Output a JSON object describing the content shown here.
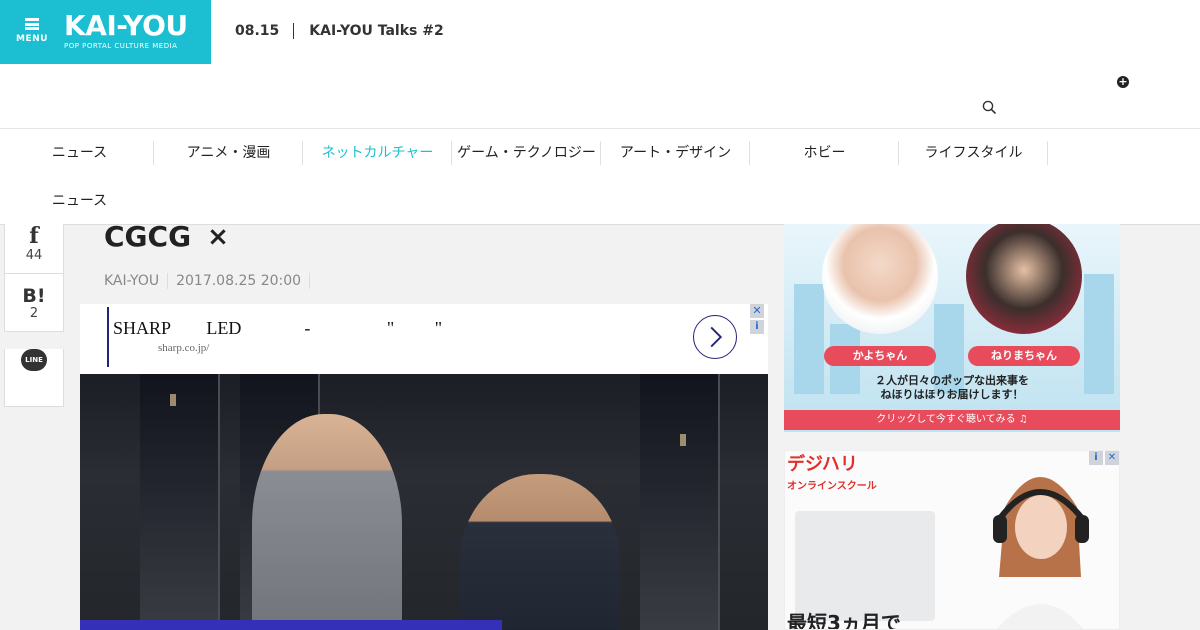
{
  "header": {
    "menu_label": "MENU",
    "brand_name": "KAI-YOU",
    "brand_tagline": "POP PORTAL CULTURE MEDIA",
    "ticker_date": "08.15",
    "ticker_headline": "KAI-YOU Talks #2",
    "plus_icon": "+"
  },
  "nav": {
    "items": [
      {
        "label": "ニュース"
      },
      {
        "label": "アニメ・漫画"
      },
      {
        "label": "ネットカルチャー"
      },
      {
        "label": "ゲーム・テクノロジー"
      },
      {
        "label": "アート・デザイン"
      },
      {
        "label": "ホビー"
      },
      {
        "label": "ライフスタイル"
      },
      {
        "label": "ニュース"
      }
    ],
    "active_index": 2
  },
  "share": {
    "facebook_glyph": "f",
    "facebook_count": "44",
    "hatena_glyph": "B!",
    "hatena_count": "2",
    "line_glyph": "LINE"
  },
  "article": {
    "title": "CGCG",
    "title_mark": "×",
    "author": "KAI-YOU",
    "timestamp": "2017.08.25 20:00"
  },
  "text_ad": {
    "line1": "SHARP        LED              -                 \"         \"",
    "url": "sharp.co.jp/",
    "close_badge": "✕",
    "info_badge": "i"
  },
  "sidebar_ad1": {
    "name_left": "かよちゃん",
    "name_right": "ねりまちゃん",
    "tagline_line1": "２人が日々のポップな出来事を",
    "tagline_line2": "ねほりはほりお届けします！",
    "cta": "クリックして今すぐ聴いてみる ♫"
  },
  "sidebar_ad2": {
    "brand": "デジハリ",
    "sub": "オンラインスクール",
    "promo": "最短3ヵ月で",
    "info_badge": "i",
    "close_badge": "✕"
  },
  "colors": {
    "brand_cyan": "#1bbfd1",
    "ad_navy": "#23237a",
    "ad_red": "#e84b5b",
    "caption_blue": "#3431b8"
  }
}
